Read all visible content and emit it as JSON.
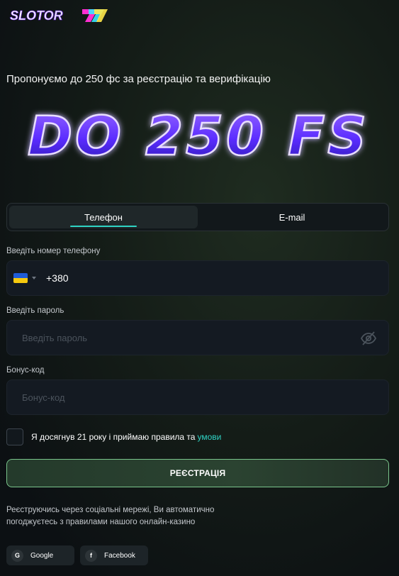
{
  "brand": {
    "logo_text": "SLOTOR777",
    "logo_icon": "slotor-logo-icon"
  },
  "offer": {
    "text": "Пропонуємо до 250 фс за реєстрацію та верифікацію",
    "banner_text": "DO 250 FS"
  },
  "tabs": [
    {
      "label": "Телефон",
      "active": true
    },
    {
      "label": "E-mail",
      "active": false
    }
  ],
  "form": {
    "phone_label": "Введіть номер телефону",
    "phone_code": "+380",
    "country_flag": "ukraine-flag-icon",
    "password_label": "Введіть пароль",
    "password_placeholder": "Введіть пароль",
    "bonus_label": "Бонус-код",
    "bonus_placeholder": "Бонус-код",
    "terms_text": "Я досягнув 21 року і приймаю правила та",
    "terms_link": "умови",
    "terms_checked": false,
    "submit_label": "РЕЄСТРАЦІЯ"
  },
  "social": {
    "note": "Реєструючись через соціальні мережі, Ви автоматично погоджуєтесь з правилами нашого онлайн-казино",
    "buttons": [
      {
        "label": "Google",
        "icon_text": "G",
        "icon": "google-icon"
      },
      {
        "label": "Facebook",
        "icon_text": "f",
        "icon": "facebook-icon"
      }
    ]
  },
  "colors": {
    "accent": "#2fd3c4",
    "register_border": "#7ac58c",
    "banner_fill": "#6d3cff"
  }
}
